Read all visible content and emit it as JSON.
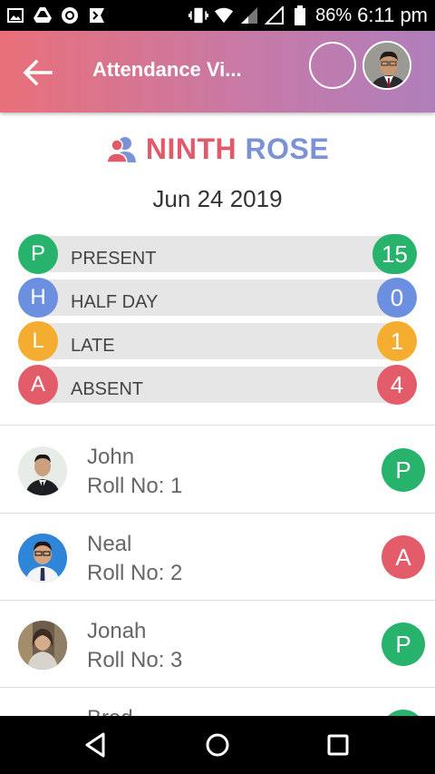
{
  "status_bar": {
    "battery": "86%",
    "time": "6:11 pm",
    "left_icons": [
      "gallery-icon",
      "drive-icon",
      "sync-icon",
      "flag-icon"
    ],
    "right_icons": [
      "vibrate-icon",
      "wifi-icon",
      "signal-icon",
      "signal-empty-icon",
      "battery-icon"
    ]
  },
  "app_bar": {
    "title": "Attendance Vi...",
    "back_icon": "arrow-left-icon"
  },
  "class": {
    "name_part1": "NINTH",
    "name_part2": "ROSE",
    "date": "Jun 24 2019"
  },
  "summary": [
    {
      "letter": "P",
      "label": "PRESENT",
      "count": "15",
      "color": "#27b36b"
    },
    {
      "letter": "H",
      "label": "HALF DAY",
      "count": "0",
      "color": "#6d8fe0"
    },
    {
      "letter": "L",
      "label": "LATE",
      "count": "1",
      "color": "#f4ad2e"
    },
    {
      "letter": "A",
      "label": "ABSENT",
      "count": "4",
      "color": "#e25c69"
    }
  ],
  "students": [
    {
      "name": "John",
      "roll": "Roll No: 1",
      "status": "P",
      "color": "#27b36b"
    },
    {
      "name": "Neal",
      "roll": "Roll No: 2",
      "status": "A",
      "color": "#e25c69"
    },
    {
      "name": "Jonah",
      "roll": "Roll No: 3",
      "status": "P",
      "color": "#27b36b"
    },
    {
      "name": "Brad",
      "roll": "",
      "status": "P",
      "color": "#27b36b"
    }
  ],
  "colors": {
    "appbar_start": "#e9707a",
    "appbar_end": "#b07fbb",
    "accent_red": "#e05a6a",
    "accent_blue": "#7b93d6"
  }
}
